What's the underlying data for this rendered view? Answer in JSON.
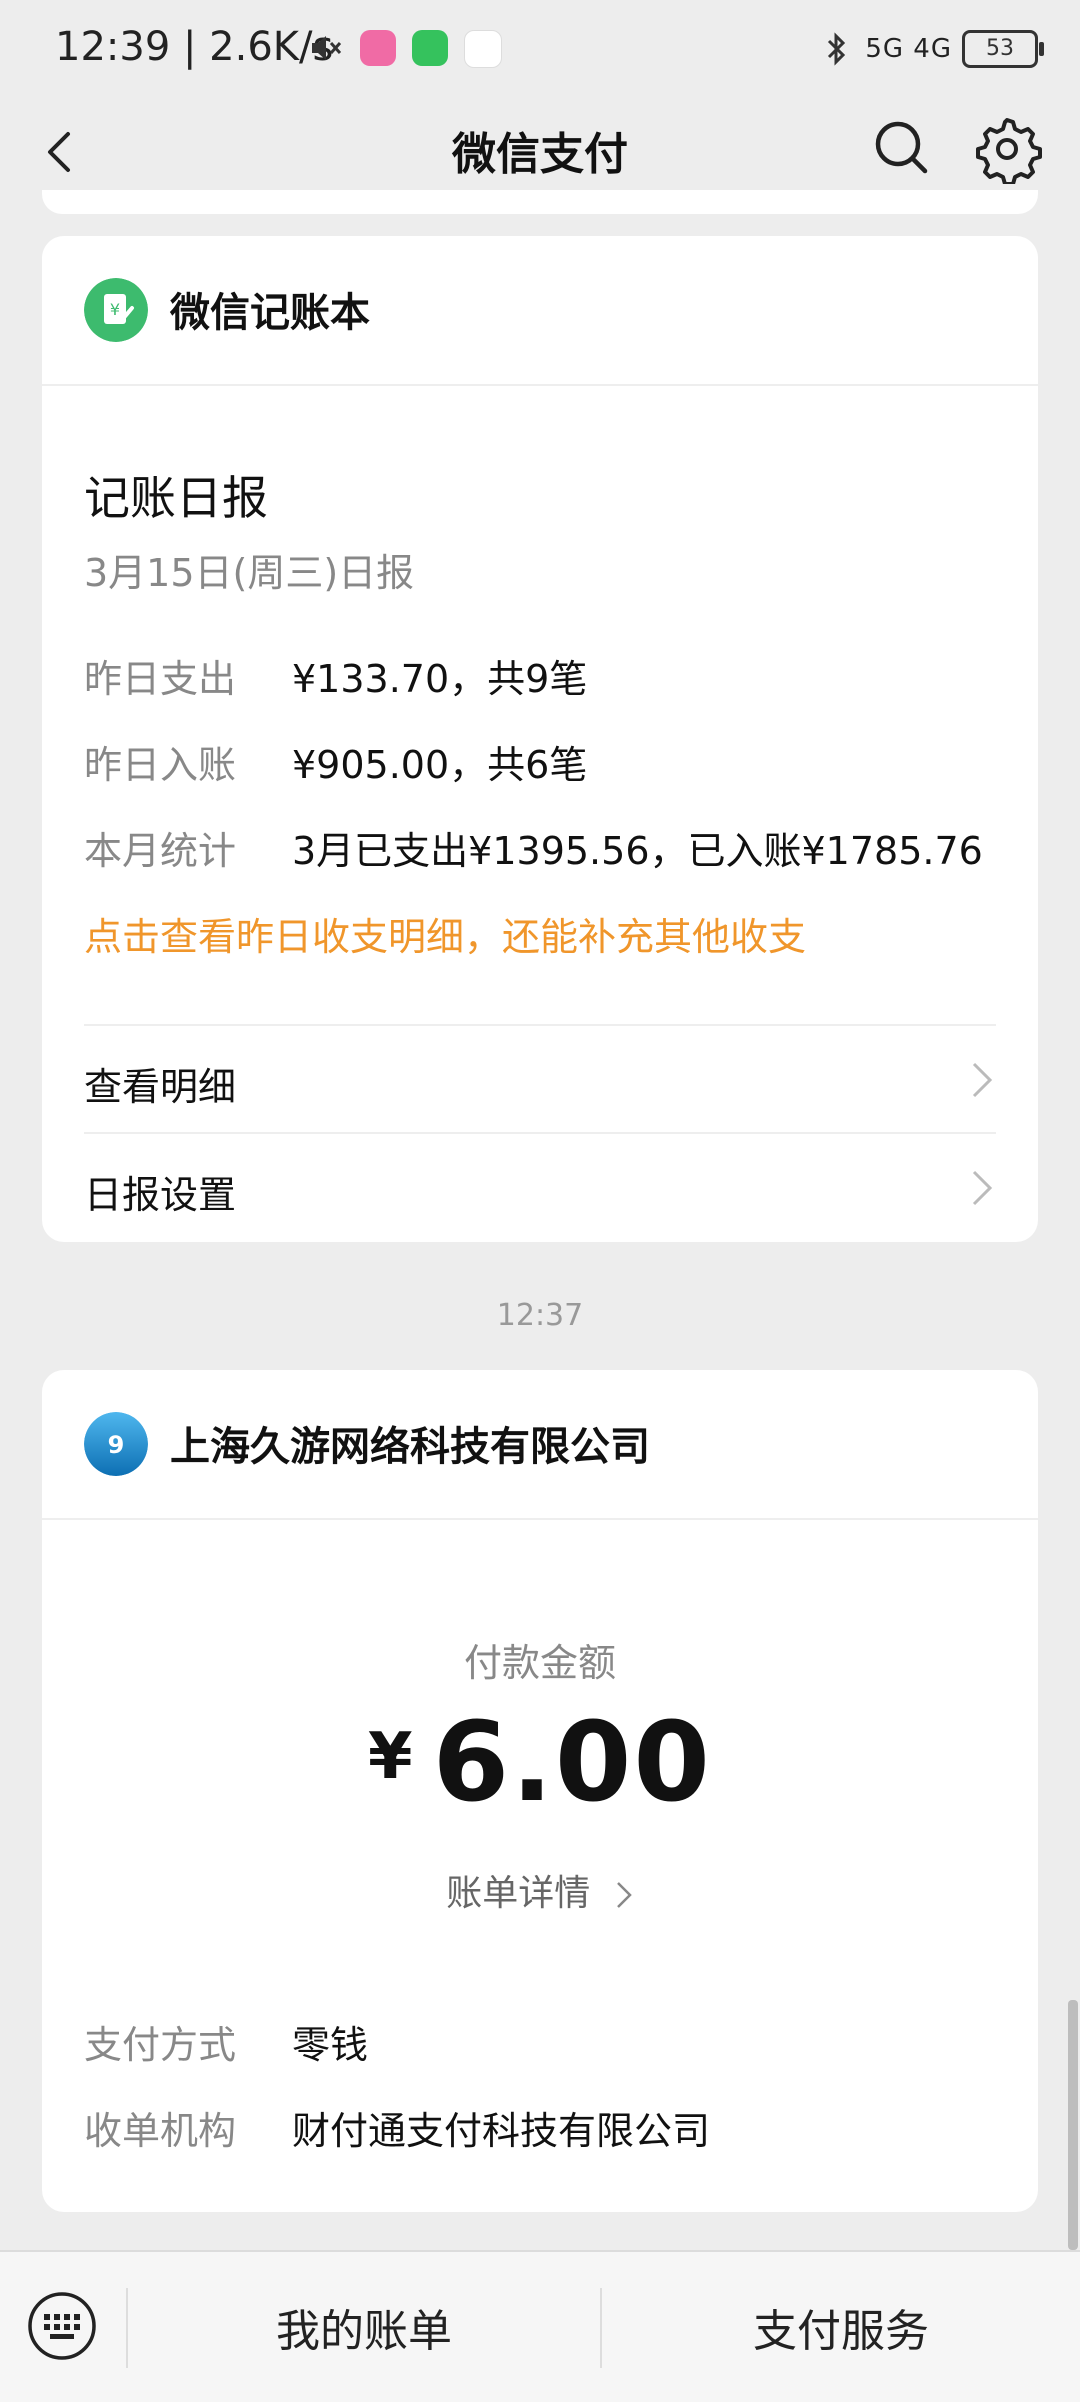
{
  "status_bar": {
    "time": "12:39 | 2.6K/s",
    "network": "5G 4G",
    "battery": "53"
  },
  "header": {
    "title": "微信支付"
  },
  "ledger_card": {
    "name": "微信记账本",
    "report_title": "记账日报",
    "report_date": "3月15日(周三)日报",
    "rows": [
      {
        "label": "昨日支出",
        "value": "¥133.70，共9笔"
      },
      {
        "label": "昨日入账",
        "value": "¥905.00，共6笔"
      },
      {
        "label": "本月统计",
        "value": "3月已支出¥1395.56，已入账¥1785.76"
      }
    ],
    "link_text": "点击查看昨日收支明细，还能补充其他收支",
    "menu": [
      {
        "label": "查看明细"
      },
      {
        "label": "日报设置"
      }
    ]
  },
  "timestamp": "12:37",
  "payment_card": {
    "merchant": "上海久游网络科技有限公司",
    "amount_label": "付款金额",
    "currency_symbol": "¥",
    "amount": "6.00",
    "bill_link": "账单详情",
    "rows": [
      {
        "label": "支付方式",
        "value": "零钱"
      },
      {
        "label": "收单机构",
        "value": "财付通支付科技有限公司"
      }
    ]
  },
  "bottom_bar": {
    "tabs": [
      {
        "label": "我的账单"
      },
      {
        "label": "支付服务"
      }
    ]
  },
  "colors": {
    "accent_orange": "#f0962b",
    "ledger_green": "#3dbb6e",
    "merchant_blue": "#1e8fd1"
  }
}
